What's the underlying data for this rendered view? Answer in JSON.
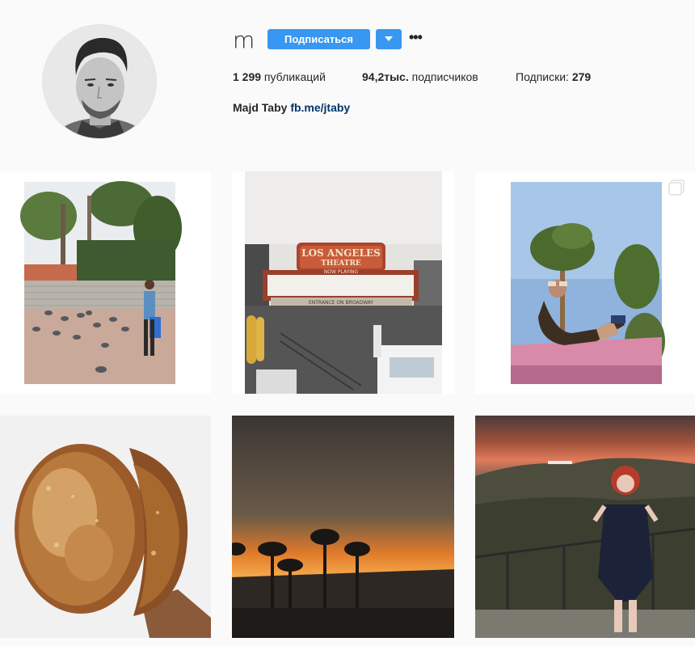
{
  "profile": {
    "username": "m",
    "follow_label": "Подписаться",
    "more_label": "•••",
    "stats": {
      "posts_count": "1 299",
      "posts_label": " публикаций",
      "followers_count": "94,2тыс.",
      "followers_label": " подписчиков",
      "following_label": "Подписки: ",
      "following_count": "279"
    },
    "bio": {
      "name": "Majd Taby",
      "link": "fb.me/jtaby"
    }
  },
  "colors": {
    "accent": "#3897f0",
    "link": "#003569",
    "background": "#fafafa"
  },
  "posts": [
    {
      "subject": "pigeons-plaza"
    },
    {
      "subject": "los-angeles-theatre"
    },
    {
      "subject": "woman-on-car-roof",
      "multi_icon": "carousel-icon"
    },
    {
      "subject": "bread-loaf"
    },
    {
      "subject": "palm-sunset"
    },
    {
      "subject": "hollywood-sign-woman"
    }
  ],
  "theatre_sign": {
    "line1": "LOS ANGELES",
    "line2": "THEATRE",
    "line3": "NOW PLAYING",
    "line4": "ENTRANCE ON BROADWAY"
  }
}
